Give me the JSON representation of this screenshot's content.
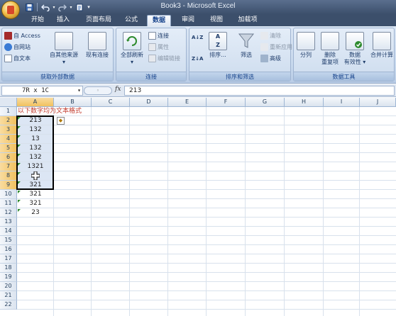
{
  "titlebar": {
    "title": "Book3 - Microsoft Excel",
    "qat": [
      "save-icon",
      "undo-icon",
      "redo-icon",
      "customize-icon"
    ]
  },
  "tabs": [
    {
      "label": "开始",
      "active": false
    },
    {
      "label": "插入",
      "active": false
    },
    {
      "label": "页面布局",
      "active": false
    },
    {
      "label": "公式",
      "active": false
    },
    {
      "label": "数据",
      "active": true
    },
    {
      "label": "审阅",
      "active": false
    },
    {
      "label": "视图",
      "active": false
    },
    {
      "label": "加载项",
      "active": false
    }
  ],
  "ribbon": {
    "external_data": {
      "group_label": "获取外部数据",
      "access": "自 Access",
      "web": "自网站",
      "text": "自文本",
      "other_sources": "自其他来源",
      "existing": "现有连接"
    },
    "connections": {
      "group_label": "连接",
      "refresh_all": "全部刷新",
      "connections": "连接",
      "properties": "属性",
      "edit_links": "编辑链接"
    },
    "sort_filter": {
      "group_label": "排序和筛选",
      "sort": "排序...",
      "filter": "筛选",
      "clear": "清除",
      "reapply": "重新应用",
      "advanced": "高级"
    },
    "data_tools": {
      "group_label": "数据工具",
      "text_to_columns": "分列",
      "remove_duplicates_1": "删除",
      "remove_duplicates_2": "重复项",
      "validation_1": "数据",
      "validation_2": "有效性",
      "consolidate": "合并计算"
    }
  },
  "formula_bar": {
    "name_box": "7R x 1C",
    "fx": "fx",
    "formula": "213"
  },
  "grid": {
    "columns": [
      "A",
      "B",
      "C",
      "D",
      "E",
      "F",
      "G",
      "H",
      "I",
      "J"
    ],
    "rows": [
      "1",
      "2",
      "3",
      "4",
      "5",
      "6",
      "7",
      "8",
      "9",
      "10",
      "11",
      "12",
      "13",
      "14",
      "15",
      "16",
      "17",
      "18",
      "19",
      "20",
      "21",
      "22"
    ],
    "a1": "以下数字均为文本格式",
    "values": [
      "213",
      "132",
      "13",
      "132",
      "132",
      "1321",
      "3",
      "321",
      "321",
      "321",
      "23"
    ],
    "selected_column": "A",
    "selected_rows": [
      "2",
      "3",
      "4",
      "5",
      "6",
      "7",
      "8",
      "9"
    ]
  }
}
